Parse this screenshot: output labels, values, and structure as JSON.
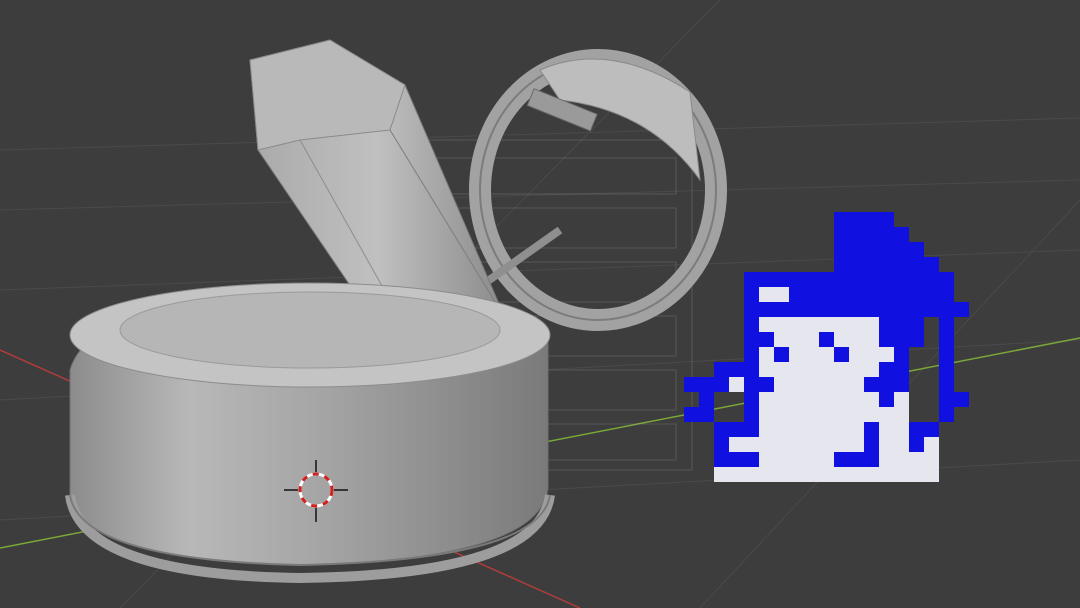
{
  "viewport": {
    "background": "#3d3d3d",
    "grid_color": "#4a4a4a",
    "x_axis_color": "#b23b3b",
    "y_axis_color": "#7aa63a",
    "caption": ""
  },
  "scene": {
    "objects": [
      "base-cylinder",
      "crystal-pillar",
      "ring-band",
      "ghost-reference-image"
    ],
    "object_color": "#9d9d9d",
    "cursor": "3d-cursor-icon"
  },
  "sprite": {
    "name": "pixel-ninja-sprite",
    "primary_color": "#1010e0",
    "secondary_color": "#e6e6ef"
  }
}
